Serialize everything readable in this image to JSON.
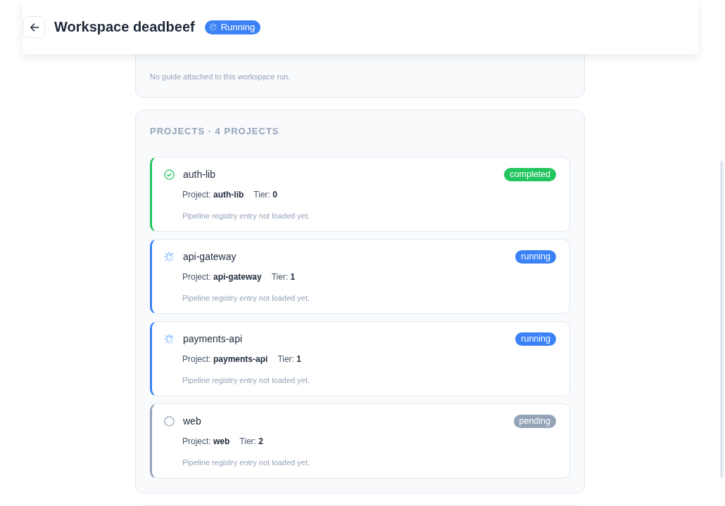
{
  "header": {
    "title": "Workspace deadbeef",
    "status": {
      "label": "Running",
      "kind": "running"
    }
  },
  "guide": {
    "note": "No guide attached to this workspace run."
  },
  "projects": {
    "heading": "PROJECTS · 4 PROJECTS",
    "items": [
      {
        "name": "auth-lib",
        "kind": "completed",
        "status": "completed",
        "project": "Project: **auth-lib**",
        "tier": "Tier: **0**",
        "note": "Pipeline registry entry not loaded yet."
      },
      {
        "name": "api-gateway",
        "kind": "running",
        "status": "running",
        "project": "Project: **api-gateway**",
        "tier": "Tier: **1**",
        "note": "Pipeline registry entry not loaded yet."
      },
      {
        "name": "payments-api",
        "kind": "running",
        "status": "running",
        "project": "Project: **payments-api**",
        "tier": "Tier: **1**",
        "note": "Pipeline registry entry not loaded yet."
      },
      {
        "name": "web",
        "kind": "pending",
        "status": "pending",
        "project": "Project: **web**",
        "tier": "Tier: **2**",
        "note": "Pipeline registry entry not loaded yet."
      }
    ]
  }
}
